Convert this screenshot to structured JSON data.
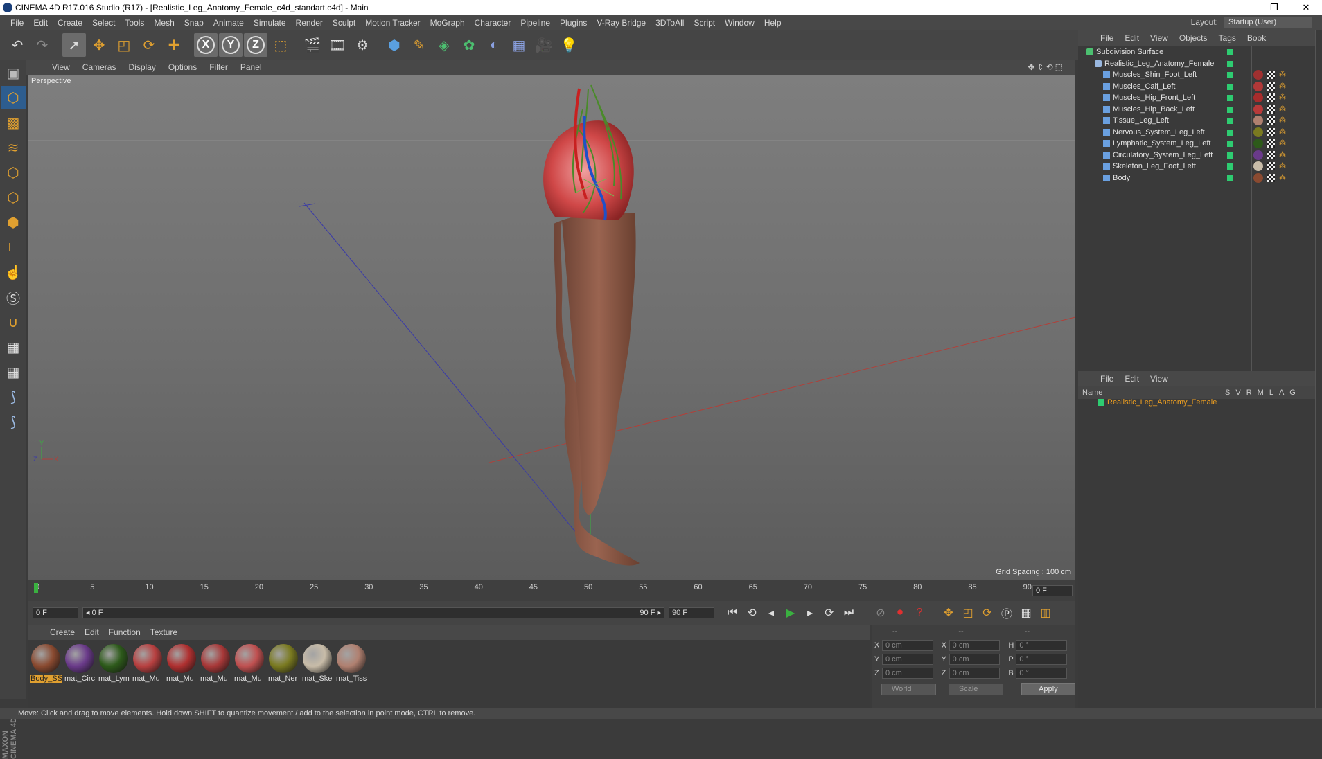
{
  "window": {
    "title": "CINEMA 4D R17.016 Studio (R17) - [Realistic_Leg_Anatomy_Female_c4d_standart.c4d] - Main",
    "min": "–",
    "restore": "❐",
    "close": "✕"
  },
  "menu": [
    "File",
    "Edit",
    "Create",
    "Select",
    "Tools",
    "Mesh",
    "Snap",
    "Animate",
    "Simulate",
    "Render",
    "Sculpt",
    "Motion Tracker",
    "MoGraph",
    "Character",
    "Pipeline",
    "Plugins",
    "V-Ray Bridge",
    "3DToAll",
    "Script",
    "Window",
    "Help"
  ],
  "layout": {
    "label": "Layout:",
    "value": "Startup (User)"
  },
  "toolbar": {
    "undo": "undo-icon",
    "redo": "redo-icon",
    "axes": [
      "X",
      "Y",
      "Z"
    ]
  },
  "viewport": {
    "menu": [
      "View",
      "Cameras",
      "Display",
      "Options",
      "Filter",
      "Panel"
    ],
    "label": "Perspective",
    "grid_spacing": "Grid Spacing : 100 cm",
    "axis_labels": {
      "y": "Y",
      "z": "Z",
      "x": "X"
    }
  },
  "timeline": {
    "ticks": [
      "0",
      "5",
      "10",
      "15",
      "20",
      "25",
      "30",
      "35",
      "40",
      "45",
      "50",
      "55",
      "60",
      "65",
      "70",
      "75",
      "80",
      "85",
      "90"
    ],
    "frame": "0 F"
  },
  "transport": {
    "start": "0 F",
    "range_start": "◂ 0 F",
    "range_end": "90 F ▸",
    "end": "90 F"
  },
  "material_manager": {
    "menu": [
      "Create",
      "Edit",
      "Function",
      "Texture"
    ],
    "materials": [
      {
        "label": "Body_SS",
        "color": "#8a4a30",
        "selected": true
      },
      {
        "label": "mat_Circ",
        "color": "#6a3a8a",
        "selected": false
      },
      {
        "label": "mat_Lym",
        "color": "#2d5a1a",
        "selected": false
      },
      {
        "label": "mat_Mu",
        "color": "#b84040",
        "selected": false
      },
      {
        "label": "mat_Mu",
        "color": "#b03030",
        "selected": false
      },
      {
        "label": "mat_Mu",
        "color": "#a83838",
        "selected": false
      },
      {
        "label": "mat_Mu",
        "color": "#c05050",
        "selected": false
      },
      {
        "label": "mat_Ner",
        "color": "#7a7a20",
        "selected": false
      },
      {
        "label": "mat_Ske",
        "color": "#c8bca8",
        "selected": false
      },
      {
        "label": "mat_Tiss",
        "color": "#b08070",
        "selected": false
      }
    ]
  },
  "coordinates": {
    "headers": [
      "--",
      "--",
      "--"
    ],
    "rows": [
      {
        "a": "X",
        "v1": "0 cm",
        "b": "X",
        "v2": "0 cm",
        "c": "H",
        "v3": "0 °"
      },
      {
        "a": "Y",
        "v1": "0 cm",
        "b": "Y",
        "v2": "0 cm",
        "c": "P",
        "v3": "0 °"
      },
      {
        "a": "Z",
        "v1": "0 cm",
        "b": "Z",
        "v2": "0 cm",
        "c": "B",
        "v3": "0 °"
      }
    ],
    "world": "World",
    "scale": "Scale",
    "apply": "Apply"
  },
  "object_manager": {
    "menu": [
      "File",
      "Edit",
      "View",
      "Objects",
      "Tags",
      "Book"
    ],
    "objects": [
      {
        "name": "Subdivision Surface",
        "indent": 0
      },
      {
        "name": "Realistic_Leg_Anatomy_Female",
        "indent": 1
      },
      {
        "name": "Muscles_Shin_Foot_Left",
        "indent": 2,
        "tag": "#a03030"
      },
      {
        "name": "Muscles_Calf_Left",
        "indent": 2,
        "tag": "#b03838"
      },
      {
        "name": "Muscles_Hip_Front_Left",
        "indent": 2,
        "tag": "#a82c2c"
      },
      {
        "name": "Muscles_Hip_Back_Left",
        "indent": 2,
        "tag": "#b83a3a"
      },
      {
        "name": "Tissue_Leg_Left",
        "indent": 2,
        "tag": "#b08070"
      },
      {
        "name": "Nervous_System_Leg_Left",
        "indent": 2,
        "tag": "#7a7a20"
      },
      {
        "name": "Lymphatic_System_Leg_Left",
        "indent": 2,
        "tag": "#2d5a1a"
      },
      {
        "name": "Circulatory_System_Leg_Left",
        "indent": 2,
        "tag": "#6a3a8a"
      },
      {
        "name": "Skeleton_Leg_Foot_Left",
        "indent": 2,
        "tag": "#c8bca8"
      },
      {
        "name": "Body",
        "indent": 2,
        "tag": "#8a4a30"
      }
    ]
  },
  "layer_manager": {
    "menu": [
      "File",
      "Edit",
      "View"
    ],
    "header_name": "Name",
    "cols": [
      "S",
      "V",
      "R",
      "M",
      "L",
      "A",
      "G"
    ],
    "row": "Realistic_Leg_Anatomy_Female"
  },
  "status": "Move: Click and drag to move elements. Hold down SHIFT to quantize movement / add to the selection in point mode, CTRL to remove."
}
